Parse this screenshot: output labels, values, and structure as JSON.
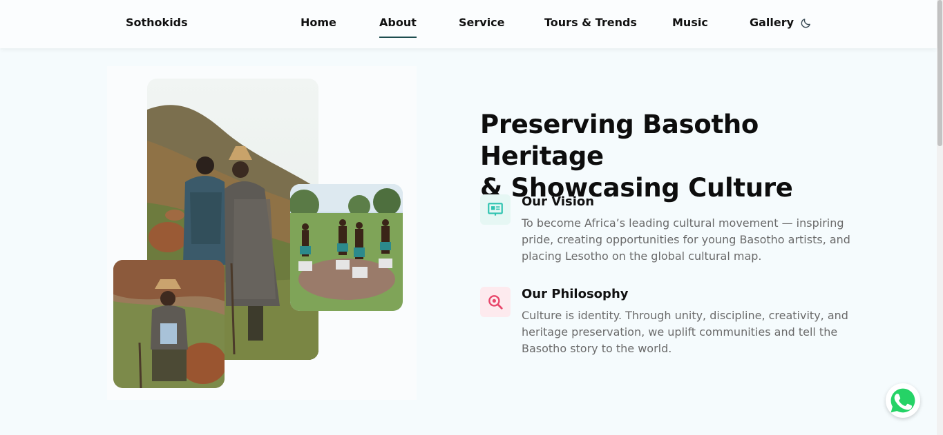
{
  "header": {
    "brand": "Sothokids",
    "nav": [
      {
        "label": "Home",
        "active": false
      },
      {
        "label": "About",
        "active": true
      },
      {
        "label": "Service",
        "active": false
      },
      {
        "label": "Tours & Trends",
        "active": false
      },
      {
        "label": "Music",
        "active": false
      },
      {
        "label": "Gallery",
        "active": false
      }
    ],
    "theme_toggle_icon": "moon-icon"
  },
  "about": {
    "headline_line1": "Preserving Basotho Heritage",
    "headline_line2": "& Showcasing Culture",
    "features": [
      {
        "icon": "presentation-icon",
        "icon_color": "#2fc3b0",
        "icon_bg": "#e6f7f4",
        "title": "Our Vision",
        "text": "To become Africa’s leading cultural movement — inspiring pride, creating opportunities for young Basotho artists, and placing Lesotho on the global cultural map."
      },
      {
        "icon": "magnifier-icon",
        "icon_color": "#e8476b",
        "icon_bg": "#fdeaee",
        "title": "Our Philosophy",
        "text": "Culture is identity. Through unity, discipline, creativity, and heritage preservation, we uplift communities and tell the Basotho story to the world."
      }
    ]
  },
  "floating": {
    "whatsapp_icon": "whatsapp-icon",
    "whatsapp_color": "#25d366"
  },
  "colors": {
    "page_bg": "#f5fbfd",
    "nav_underline": "#1d4d4f",
    "body_text": "#6a6a6a"
  }
}
